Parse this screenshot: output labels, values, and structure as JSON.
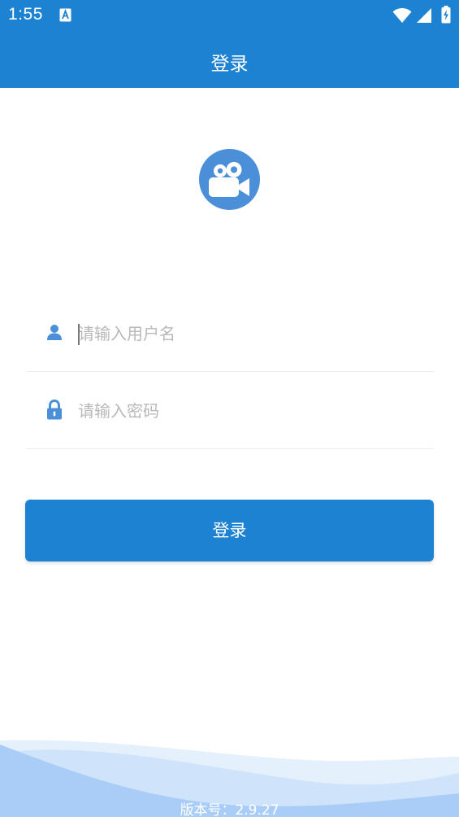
{
  "status_bar": {
    "time": "1:55",
    "icons": [
      "text-a-icon",
      "wifi-icon",
      "signal-icon",
      "battery-charging-icon"
    ]
  },
  "app_bar": {
    "title": "登录"
  },
  "logo": {
    "icon": "video-camera-icon"
  },
  "form": {
    "username": {
      "icon": "user-icon",
      "placeholder": "请输入用户名",
      "value": ""
    },
    "password": {
      "icon": "lock-icon",
      "placeholder": "请输入密码",
      "value": ""
    },
    "submit_label": "登录"
  },
  "footer": {
    "version": "版本号：2.9.27"
  },
  "colors": {
    "primary": "#1e82d2",
    "logo_bg": "#4a8fd7",
    "icon": "#4a8fd7",
    "placeholder": "#b8b8b8",
    "wave_light": "#d6e8fb",
    "wave_dark": "#a9cdf6"
  }
}
